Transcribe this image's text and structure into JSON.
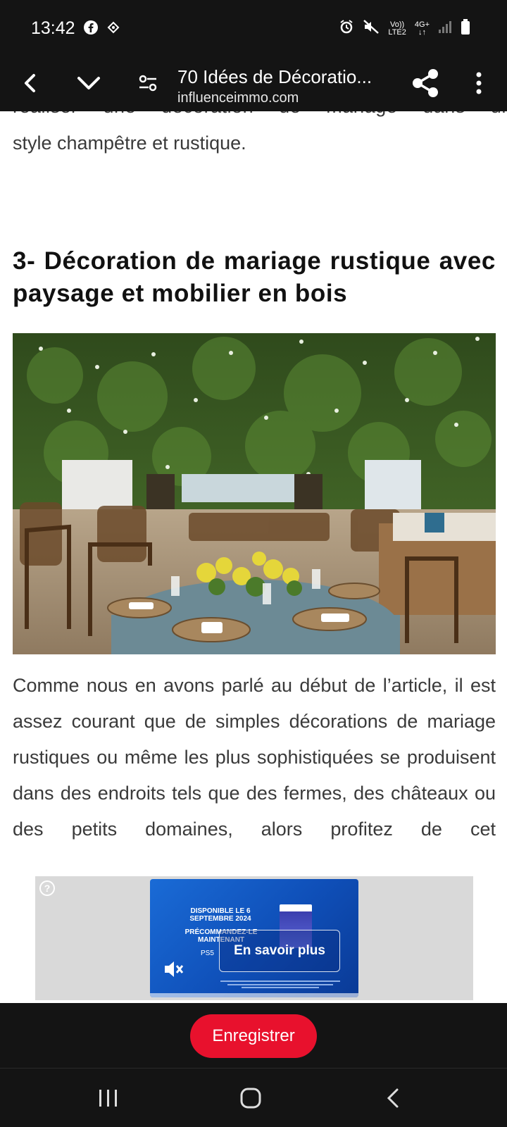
{
  "status_bar": {
    "time": "13:42",
    "network_top": "Vo))",
    "network_bottom": "LTE2",
    "network_type": "4G+",
    "icons": [
      "facebook-icon",
      "location-tag-icon",
      "alarm-icon",
      "mute-icon",
      "signal-icon",
      "battery-icon"
    ]
  },
  "toolbar": {
    "page_title": "70 Idées de Décoratio...",
    "domain": "influenceimmo.com",
    "icons": [
      "back-arrow-icon",
      "chevron-down-icon",
      "filter-sliders-icon",
      "share-icon",
      "more-vert-icon"
    ]
  },
  "article": {
    "cut_top_line": "réaliser une décoration de mariage dans un",
    "paragraph_end": "style champêtre et rustique.",
    "heading": "3- Décoration de mariage rustique avec paysage et mobilier en bois",
    "body": "Comme nous en avons parlé au début de l’article, il est assez courant que de simples décorations de mariage rustiques ou même les plus sophistiquées se produisent dans des endroits tels que des fermes, des châteaux ou des petits domaines, alors profitez de cet"
  },
  "ad": {
    "date_text": "DISPONIBLE LE 6 SEPTEMBRE 2024",
    "preorder_text": "PRÉCOMMANDEZ-LE MAINTENANT",
    "platform": "PS5",
    "cta": "En savoir plus",
    "help": "?"
  },
  "bottom_bar": {
    "save_label": "Enregistrer",
    "accent": "#e8112d"
  },
  "colors": {
    "bar_background": "#141414",
    "floating_button": "#5aad2a"
  }
}
